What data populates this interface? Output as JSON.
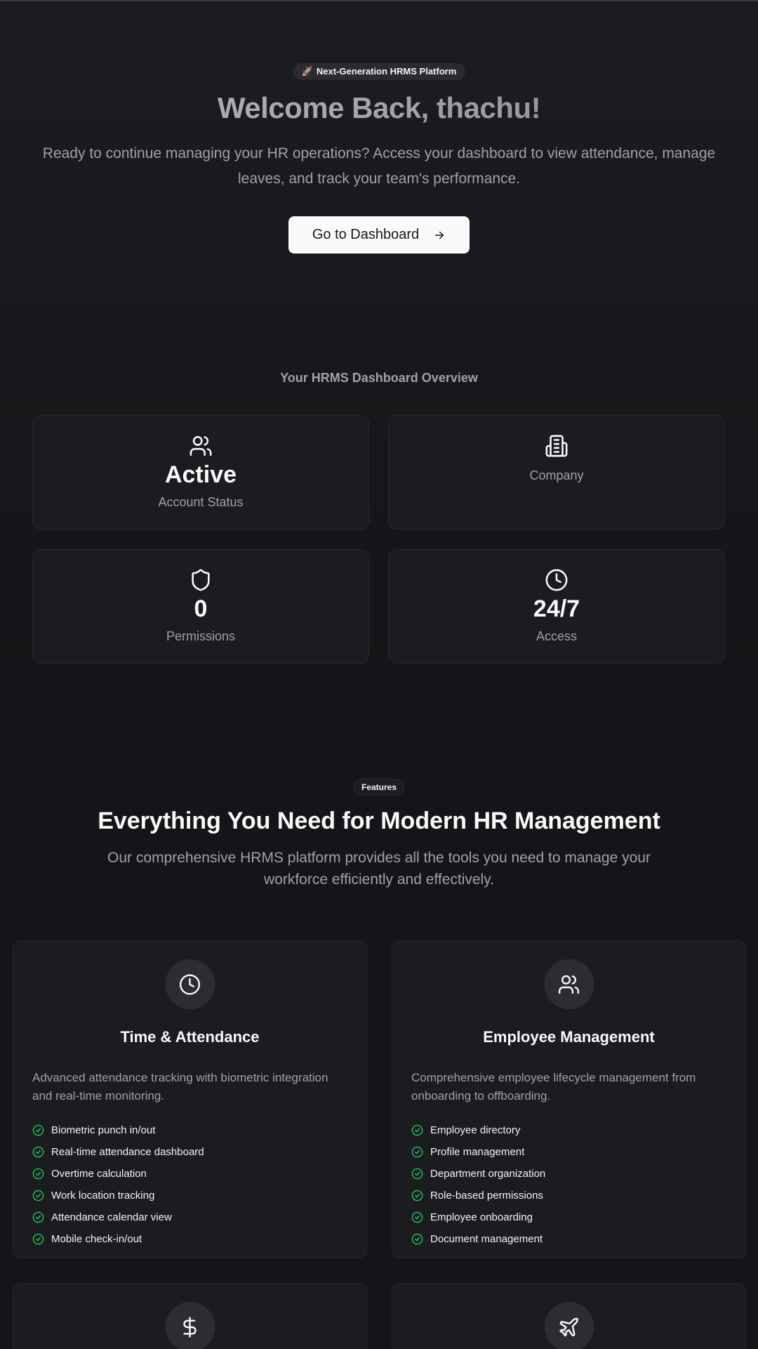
{
  "hero": {
    "badge_icon": "🚀",
    "badge_text": "Next-Generation HRMS Platform",
    "title": "Welcome Back, thachu!",
    "description": "Ready to continue managing your HR operations? Access your dashboard to view attendance, manage leaves, and track your team's performance.",
    "cta_label": "Go to Dashboard",
    "cta_icon": "arrow-right-icon"
  },
  "overview": {
    "title": "Your HRMS Dashboard Overview",
    "cards": [
      {
        "icon": "users-icon",
        "value": "Active",
        "label": "Account Status"
      },
      {
        "icon": "building-icon",
        "value": "",
        "label": "Company"
      },
      {
        "icon": "shield-icon",
        "value": "0",
        "label": "Permissions"
      },
      {
        "icon": "clock-icon",
        "value": "24/7",
        "label": "Access"
      }
    ]
  },
  "features": {
    "badge": "Features",
    "title": "Everything You Need for Modern HR Management",
    "description": "Our comprehensive HRMS platform provides all the tools you need to manage your workforce efficiently and effectively.",
    "cards": [
      {
        "icon": "clock-icon",
        "title": "Time & Attendance",
        "description": "Advanced attendance tracking with biometric integration and real-time monitoring.",
        "items": [
          "Biometric punch in/out",
          "Real-time attendance dashboard",
          "Overtime calculation",
          "Work location tracking",
          "Attendance calendar view",
          "Mobile check-in/out"
        ]
      },
      {
        "icon": "users-icon",
        "title": "Employee Management",
        "description": "Comprehensive employee lifecycle management from onboarding to offboarding.",
        "items": [
          "Employee directory",
          "Profile management",
          "Department organization",
          "Role-based permissions",
          "Employee onboarding",
          "Document management"
        ]
      },
      {
        "icon": "dollar-icon"
      },
      {
        "icon": "plane-icon"
      }
    ]
  },
  "colors": {
    "background": "#141518",
    "card": "#1b1c20",
    "check": "#22c55e",
    "muted_text": "#a1a1aa"
  }
}
